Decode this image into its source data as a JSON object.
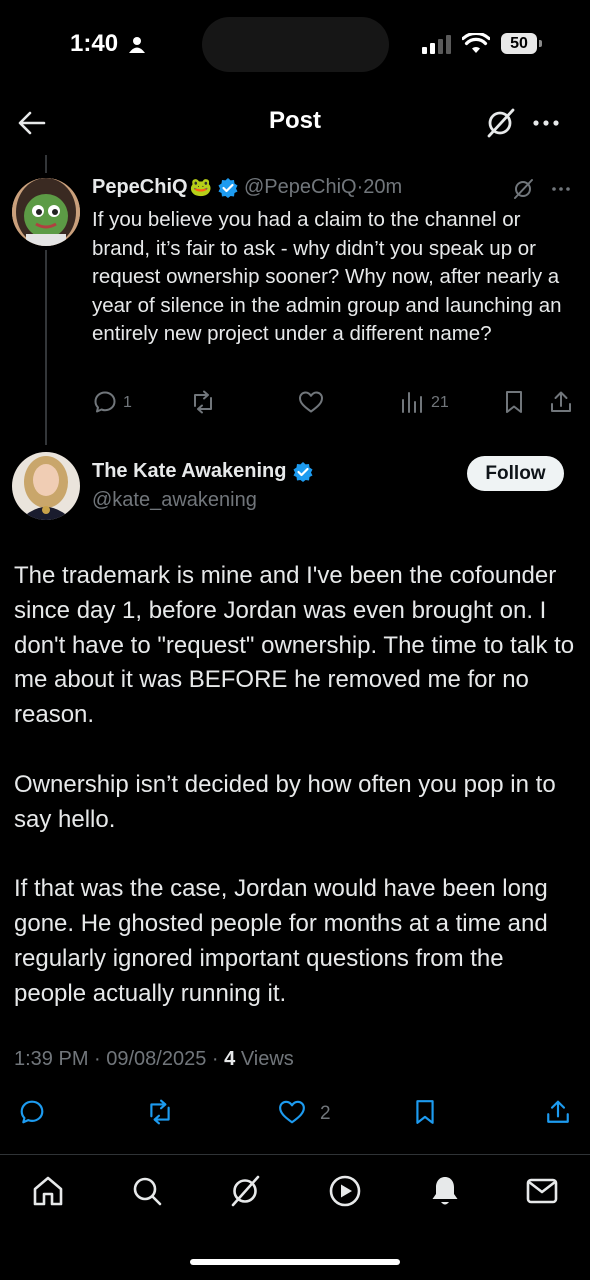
{
  "status_bar": {
    "time": "1:40",
    "battery": "50"
  },
  "header": {
    "title": "Post"
  },
  "parent_tweet": {
    "name": "PepeChiQ",
    "emoji": "🐸",
    "handle": "@PepeChiQ",
    "separator": "·",
    "age": "20m",
    "text": "If you believe you had a claim to the channel or brand, it’s fair to ask - why didn’t you speak up or request ownership sooner? Why now, after nearly a year of silence in the admin group and launching an entirely new project under a different name?",
    "replies": "1",
    "views": "21"
  },
  "main_tweet": {
    "name": "The Kate Awakening",
    "handle": "@kate_awakening",
    "follow_label": "Follow",
    "paragraphs": [
      "The trademark is mine and I've been the cofounder since day 1, before Jordan was even brought on. I don't have to \"request\" ownership. The time to talk to me about it was BEFORE he removed me for no reason.",
      "Ownership isn’t decided by how often you pop in to say hello.",
      "If that was the case, Jordan would have been long gone. He ghosted people for months at a time and regularly ignored important questions from the people actually running it."
    ],
    "timestamp": "1:39 PM · 09/08/2025 · ",
    "views_count": "4",
    "views_label": " Views",
    "likes": "2"
  },
  "colors": {
    "accent": "#1d9bf0",
    "muted": "#71767b",
    "text": "#e7e9ea",
    "background": "#000000"
  },
  "icons": {
    "header": [
      "back-arrow-icon",
      "grok-icon",
      "more-icon"
    ],
    "actions": [
      "reply-icon",
      "repost-icon",
      "like-icon",
      "views-icon",
      "bookmark-icon",
      "share-icon"
    ],
    "tabs": [
      "home-icon",
      "search-icon",
      "grok-icon",
      "video-icon",
      "notifications-icon",
      "messages-icon"
    ]
  }
}
